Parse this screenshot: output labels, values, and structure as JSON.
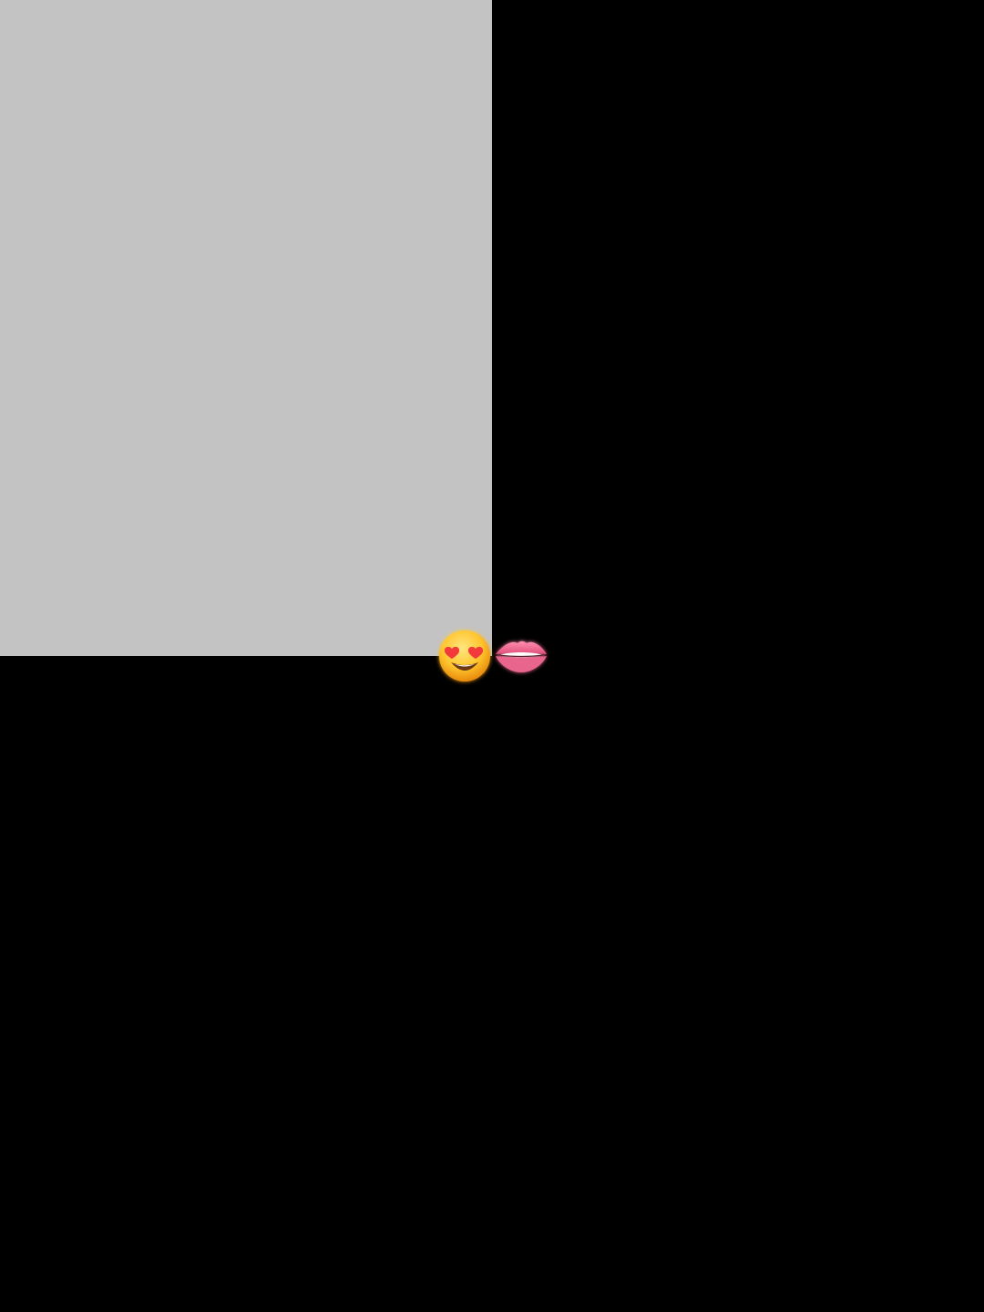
{
  "page": {
    "background_color": "#000000"
  },
  "panel": {
    "color": "#c3c3c3"
  },
  "emojis": [
    {
      "name": "smiling-face-with-heart-eyes",
      "icon": "heart-eyes-face-icon"
    },
    {
      "name": "biting-lip",
      "icon": "biting-lip-icon"
    }
  ]
}
